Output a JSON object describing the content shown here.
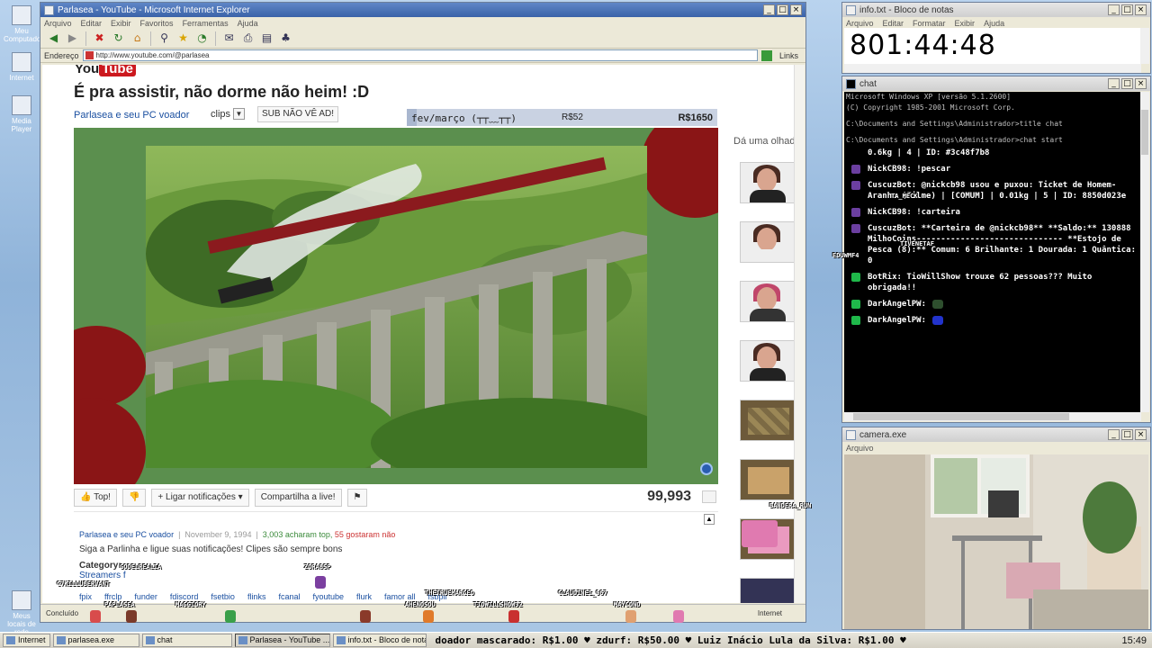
{
  "desktop": {
    "icons": [
      "Meu Computador",
      "Internet",
      "Media Player",
      "Meus locais de rede"
    ]
  },
  "ie": {
    "title": "Parlasea - YouTube - Microsoft Internet Explorer",
    "menu": [
      "Arquivo",
      "Editar",
      "Exibir",
      "Favoritos",
      "Ferramentas",
      "Ajuda"
    ],
    "address_label": "Endereço",
    "url": "http://www.youtube.com/@parlasea",
    "links_label": "Links",
    "status_left": "Concluído",
    "status_zone": "Internet"
  },
  "youtube": {
    "logo_you": "You",
    "logo_tube": "Tube",
    "video_title": "É pra assistir, não dorme não heim! :D",
    "channel": "Parlasea e seu PC voador",
    "clips_label": "clips",
    "subscribe_label": "SUB NÃO VÊ AD!",
    "goal": {
      "label": "fev/março (┬┬﹏┬┬)",
      "current": "R$52",
      "target": "R$1650",
      "progress_fraction": 0.032
    },
    "actions": {
      "like": "Top!",
      "notify": "Ligar notificações",
      "share": "Compartilha a live!"
    },
    "view_count": "99,993",
    "sidebar_label": "Dá uma olhada",
    "description": {
      "channel": "Parlasea e seu PC voador",
      "date": "November 9, 1994",
      "likes": "3,003 acharam top,",
      "dislikes": "55 gostaram não",
      "line1": "Siga a Parlinha e ligue suas notificações! Clipes são sempre bons",
      "category_label": "Category:",
      "category_value": "Streamers f",
      "tags": [
        "fpix",
        "ffrclp",
        "funder",
        "fdiscord",
        "fsetbio",
        "flinks",
        "fcanal",
        "fyoutube",
        "flurk",
        "famor all",
        "fsbpil"
      ]
    }
  },
  "notepad": {
    "title": "info.txt - Bloco de notas",
    "menu": [
      "Arquivo",
      "Editar",
      "Formatar",
      "Exibir",
      "Ajuda"
    ],
    "timer": "801:44:48"
  },
  "chat": {
    "title": "chat",
    "system_lines": [
      "Microsoft Windows XP [versão 5.1.2600]",
      "(C) Copyright 1985-2001 Microsoft Corp.",
      "",
      "C:\\Documents and Settings\\Administrador>title chat",
      "",
      "C:\\Documents and Settings\\Administrador>chat start"
    ],
    "messages": [
      {
        "user": "",
        "text": "0.6kg | 4 | ID: #3c48f7b8",
        "badge": "#6b3fa0"
      },
      {
        "user": "NickCB98:",
        "text": "!pescar",
        "badge": "#6b3fa0"
      },
      {
        "user": "CuscuzBot:",
        "text": "@nickcb98 usou e puxou: Ticket de Homem-Aranha (Filme) | [COMUM] | 0.01kg | 5 | ID: 8850d023e",
        "badge": "#6b3fa0"
      },
      {
        "user": "NickCB98:",
        "text": "!carteira",
        "badge": "#6b3fa0"
      },
      {
        "user": "CuscuzBot:",
        "text": "**Carteira de @nickcb98** **Saldo:** 130888 MilhoCoins------------------------------ **Estojo de Pesca (8):** Comum: 6 Brilhante: 1 Dourada: 1 Quântica: 0",
        "badge": "#6b3fa0"
      },
      {
        "user": "BotRix:",
        "text": "TioWillShow trouxe 62 pessoas??? Muito obrigada!!",
        "badge": "#1fb84a"
      },
      {
        "user": "DarkAngelPW:",
        "text": "",
        "badge": "#1fb84a"
      },
      {
        "user": "DarkAngelPW:",
        "text": "",
        "badge": "#1fb84a"
      }
    ]
  },
  "camera": {
    "title": "camera.exe",
    "menu": [
      "Arquivo"
    ]
  },
  "overlay_names": [
    "TA_MECK",
    "TIVENETAF",
    "EDUWMF4",
    "GODELREALIA",
    "C7KILLUBERVANT",
    "ZORA8SP",
    "PAPLASEA",
    "MAGGIORY",
    "THETRUEMARCEO",
    "CLAUDINEI_067",
    "AHENOSOU",
    "TIOWILLSHOW32",
    "MAYCOND",
    "BANDERA_RUN"
  ],
  "taskbar": {
    "items": [
      {
        "label": "Internet",
        "active": false
      },
      {
        "label": "parlasea.exe",
        "active": false
      },
      {
        "label": "chat",
        "active": false
      },
      {
        "label": "Parlasea - YouTube ...",
        "active": true
      },
      {
        "label": "info.txt - Bloco de notas",
        "active": false
      }
    ],
    "ticker": "doador mascarado: R$1.00 ♥ zdurf: R$50.00 ♥ Luiz Inácio Lula da Silva: R$1.00 ♥",
    "clock": "15:49"
  }
}
